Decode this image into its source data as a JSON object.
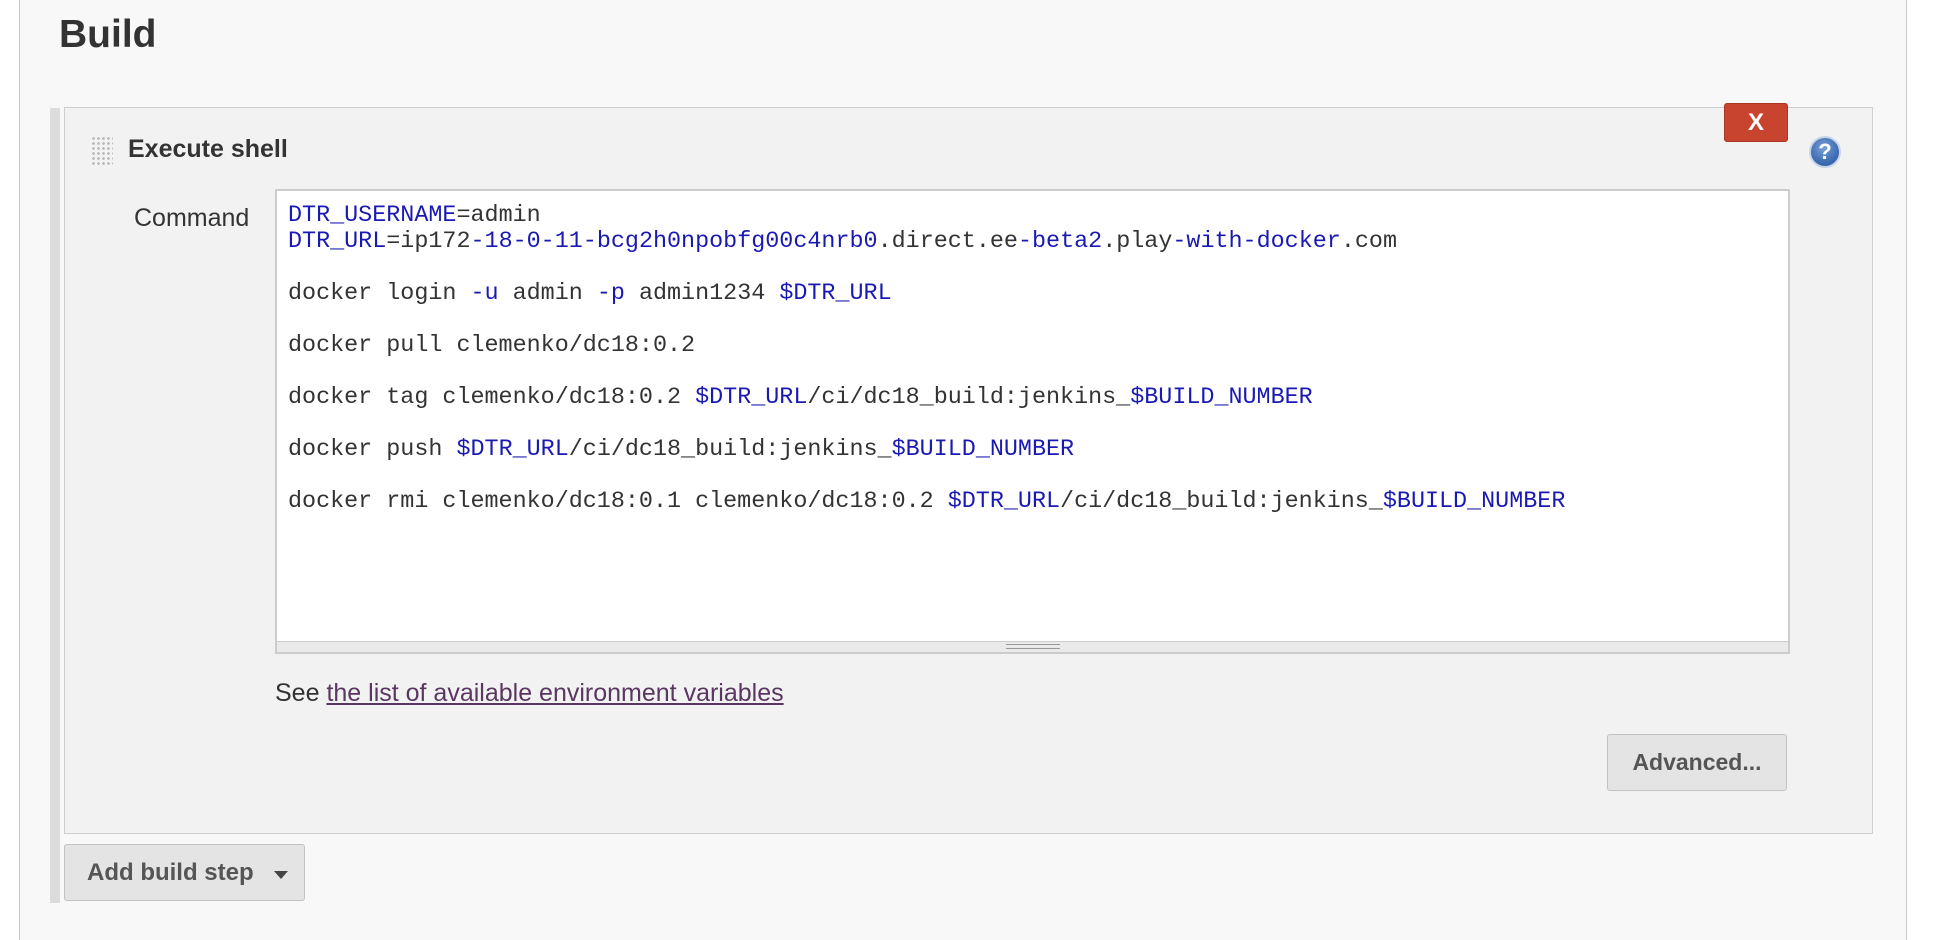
{
  "section": {
    "title": "Build"
  },
  "step": {
    "title": "Execute shell",
    "delete_label": "X",
    "help_label": "?"
  },
  "command": {
    "label": "Command",
    "lines": [
      [
        {
          "t": "DTR_USERNAME",
          "v": true
        },
        {
          "t": "=admin",
          "v": false
        }
      ],
      [
        {
          "t": "DTR_URL",
          "v": true
        },
        {
          "t": "=ip172",
          "v": false
        },
        {
          "t": "-18-0-11-bcg2h0npobfg00c4nrb0",
          "v": true
        },
        {
          "t": ".direct.ee",
          "v": false
        },
        {
          "t": "-beta2",
          "v": true
        },
        {
          "t": ".play",
          "v": false
        },
        {
          "t": "-with-docker",
          "v": true
        },
        {
          "t": ".com",
          "v": false
        }
      ],
      [],
      [
        {
          "t": "docker login ",
          "v": false
        },
        {
          "t": "-u",
          "v": true
        },
        {
          "t": " admin ",
          "v": false
        },
        {
          "t": "-p",
          "v": true
        },
        {
          "t": " admin1234 ",
          "v": false
        },
        {
          "t": "$DTR_URL",
          "v": true
        }
      ],
      [],
      [
        {
          "t": "docker pull clemenko/dc18:0.2",
          "v": false
        }
      ],
      [],
      [
        {
          "t": "docker tag clemenko/dc18:0.2 ",
          "v": false
        },
        {
          "t": "$DTR_URL",
          "v": true
        },
        {
          "t": "/ci/dc18_build:jenkins_",
          "v": false
        },
        {
          "t": "$BUILD_NUMBER",
          "v": true
        }
      ],
      [],
      [
        {
          "t": "docker push ",
          "v": false
        },
        {
          "t": "$DTR_URL",
          "v": true
        },
        {
          "t": "/ci/dc18_build:jenkins_",
          "v": false
        },
        {
          "t": "$BUILD_NUMBER",
          "v": true
        }
      ],
      [],
      [
        {
          "t": "docker rmi clemenko/dc18:0.1 clemenko/dc18:0.2 ",
          "v": false
        },
        {
          "t": "$DTR_URL",
          "v": true
        },
        {
          "t": "/ci/dc18_build:jenkins_",
          "v": false
        },
        {
          "t": "$BUILD_NUMBER",
          "v": true
        }
      ]
    ]
  },
  "env": {
    "prefix": "See ",
    "link_text": "the list of available environment variables"
  },
  "buttons": {
    "advanced": "Advanced...",
    "add_build_step": "Add build step"
  },
  "colors": {
    "delete_button": "#c9442f",
    "code_variable": "#1a1ab3",
    "link": "#5a3760"
  }
}
